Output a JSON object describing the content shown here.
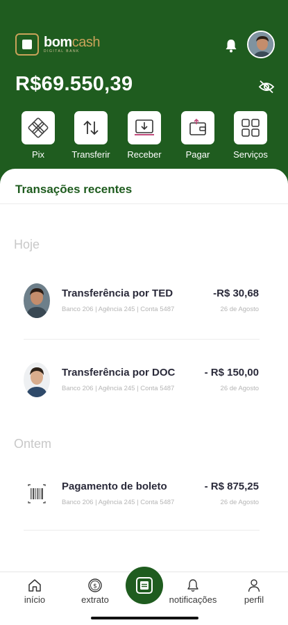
{
  "brand": {
    "name_main": "bom",
    "name_accent": "cash",
    "tagline": "DIGITAL BANK"
  },
  "header": {
    "balance": "R$69.550,39",
    "bg_color": "#1f5c1f",
    "accent_color": "#c9a35a"
  },
  "actions": [
    {
      "label": "Pix",
      "icon": "pix-icon"
    },
    {
      "label": "Transferir",
      "icon": "transfer-arrows-icon"
    },
    {
      "label": "Receber",
      "icon": "receive-icon"
    },
    {
      "label": "Pagar",
      "icon": "wallet-icon"
    },
    {
      "label": "Serviços",
      "icon": "grid-icon"
    }
  ],
  "recent": {
    "title": "Transações recentes",
    "groups": [
      {
        "label": "Hoje",
        "items": [
          {
            "title": "Transferência por TED",
            "subtitle": "Banco 206 | Agência 245 | Conta 5487",
            "amount": "-R$ 30,68",
            "date": "26 de Agosto"
          },
          {
            "title": "Transferência por DOC",
            "subtitle": "Banco 206 | Agência 245 | Conta 5487",
            "amount": "- R$ 150,00",
            "date": "26 de Agosto"
          }
        ]
      },
      {
        "label": "Ontem",
        "items": [
          {
            "title": "Pagamento de boleto",
            "subtitle": "Banco 206 | Agência 245 | Conta 5487",
            "amount": "- R$ 875,25",
            "date": "26 de Agosto"
          }
        ]
      }
    ]
  },
  "tabbar": {
    "items": [
      {
        "label": "início",
        "icon": "home-icon"
      },
      {
        "label": "extrato",
        "icon": "dollar-coin-icon"
      },
      {
        "label": "notificações",
        "icon": "bell-icon"
      },
      {
        "label": "perfil",
        "icon": "user-icon"
      }
    ]
  }
}
